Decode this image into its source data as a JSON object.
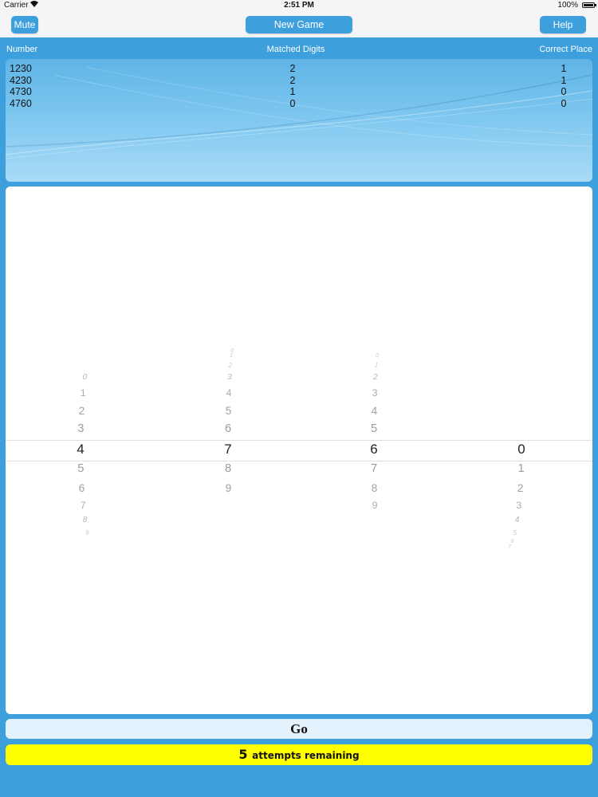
{
  "status_bar": {
    "carrier": "Carrier",
    "time": "2:51 PM",
    "battery": "100%"
  },
  "toolbar": {
    "mute_label": "Mute",
    "new_game_label": "New Game",
    "help_label": "Help"
  },
  "history": {
    "headers": [
      "Number",
      "Matched Digits",
      "Correct Place"
    ],
    "rows": [
      {
        "number": "1230",
        "matched": "2",
        "correct": "1"
      },
      {
        "number": "4230",
        "matched": "2",
        "correct": "1"
      },
      {
        "number": "4730",
        "matched": "1",
        "correct": "0"
      },
      {
        "number": "4760",
        "matched": "0",
        "correct": "0"
      }
    ]
  },
  "picker": {
    "digits": [
      "0",
      "1",
      "2",
      "3",
      "4",
      "5",
      "6",
      "7",
      "8",
      "9"
    ],
    "wheels": [
      {
        "selected": "4"
      },
      {
        "selected": "7"
      },
      {
        "selected": "6"
      },
      {
        "selected": "0"
      }
    ]
  },
  "go_label": "Go",
  "attempts": {
    "count": "5",
    "label": "attempts remaining"
  }
}
